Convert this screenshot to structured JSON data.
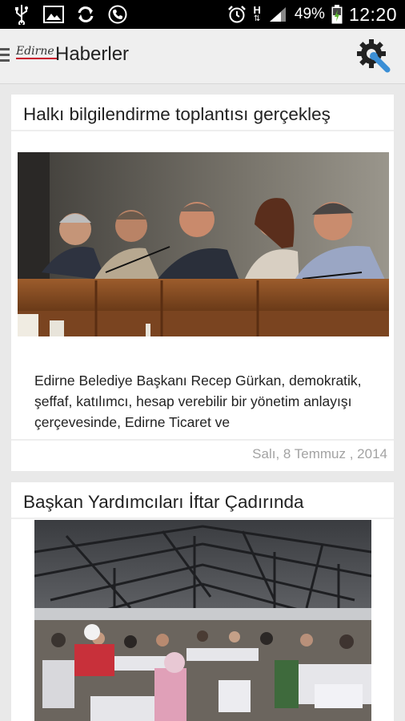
{
  "status_bar": {
    "battery": "49%",
    "time": "12:20",
    "network": "H",
    "icons": [
      "usb-icon",
      "image-icon",
      "sync-icon",
      "phone-icon",
      "alarm-icon",
      "signal-icon",
      "battery-icon"
    ]
  },
  "action_bar": {
    "logo_text": "Edirne",
    "title": "Haberler",
    "icons": [
      "menu-icon",
      "settings-icon"
    ]
  },
  "articles": [
    {
      "title": "Halkı bilgilendirme toplantısı gerçekleş",
      "excerpt": "Edirne Belediye Başkanı Recep Gürkan, demokratik, şeffaf, katılımcı, hesap verebilir bir yönetim anlayışı çerçevesinde, Edirne Ticaret ve",
      "date": "Salı, 8 Temmuz , 2014"
    },
    {
      "title": "Başkan Yardımcıları İftar Çadırında"
    }
  ],
  "colors": {
    "background": "#e9e9e9",
    "status_bar": "#000000",
    "action_bar": "#efefef",
    "card": "#ffffff",
    "date_text": "#a3a3a3",
    "accent": "#3b8fd6"
  }
}
